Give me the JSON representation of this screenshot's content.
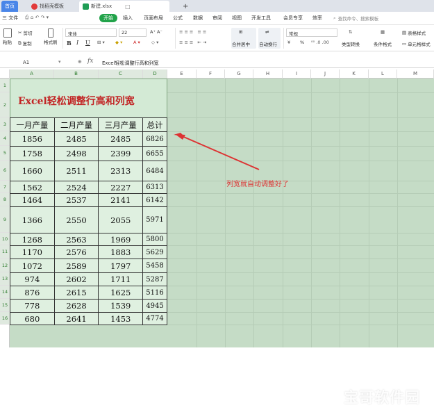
{
  "tabs": [
    {
      "label": "首页"
    },
    {
      "label": "找稻壳模板"
    },
    {
      "label": "新建.xlsx"
    }
  ],
  "menu": {
    "file": "三 文件",
    "start": "开始",
    "items": [
      "插入",
      "页面布局",
      "公式",
      "数据",
      "审阅",
      "视图",
      "开发工具",
      "会员专享",
      "效率"
    ],
    "search": "查找命令、搜索模板"
  },
  "ribbon": {
    "paste": "粘贴",
    "cut": "剪切",
    "copy": "复制",
    "format_painter": "格式刷",
    "font_name": "宋体",
    "font_size": "22",
    "bold": "B",
    "italic": "I",
    "underline": "U",
    "merge": "合并居中",
    "wrap": "自动换行",
    "number_format": "常规",
    "type_convert": "类型转换",
    "cond_format": "条件格式",
    "table_style": "表格样式",
    "cell_style": "单元格样式",
    "currency": "¥",
    "percent": "%"
  },
  "formula_bar": {
    "cell_ref": "A1",
    "fx": "fx",
    "content": "Excel轻松调整行高和列宽"
  },
  "columns": [
    "A",
    "B",
    "C",
    "D",
    "E",
    "F",
    "G",
    "H",
    "I",
    "J",
    "K",
    "L",
    "M"
  ],
  "rows": [
    "1",
    "2",
    "3",
    "4",
    "5",
    "6",
    "7",
    "8",
    "9",
    "10",
    "11",
    "12",
    "13",
    "14",
    "15",
    "16"
  ],
  "table": {
    "title": "Excel轻松调整行高和列宽",
    "headers": [
      "一月产量",
      "二月产量",
      "三月产量",
      "总计"
    ],
    "rows": [
      [
        "1856",
        "2485",
        "2485",
        "6826"
      ],
      [
        "1758",
        "2498",
        "2399",
        "6655"
      ],
      [
        "1660",
        "2511",
        "2313",
        "6484"
      ],
      [
        "1562",
        "2524",
        "2227",
        "6313"
      ],
      [
        "1464",
        "2537",
        "2141",
        "6142"
      ],
      [
        "1366",
        "2550",
        "2055",
        "5971"
      ],
      [
        "1268",
        "2563",
        "1969",
        "5800"
      ],
      [
        "1170",
        "2576",
        "1883",
        "5629"
      ],
      [
        "1072",
        "2589",
        "1797",
        "5458"
      ],
      [
        "974",
        "2602",
        "1711",
        "5287"
      ],
      [
        "876",
        "2615",
        "1625",
        "5116"
      ],
      [
        "778",
        "2628",
        "1539",
        "4945"
      ],
      [
        "680",
        "2641",
        "1453",
        "4774"
      ]
    ]
  },
  "annotation": "列宽就自动调整好了",
  "watermark": "宝哥软件园",
  "colors": {
    "sheet_bg": "#c5dcc6",
    "title_red": "#c22424",
    "annotation_red": "#dd3333",
    "start_green": "#22a34a"
  }
}
